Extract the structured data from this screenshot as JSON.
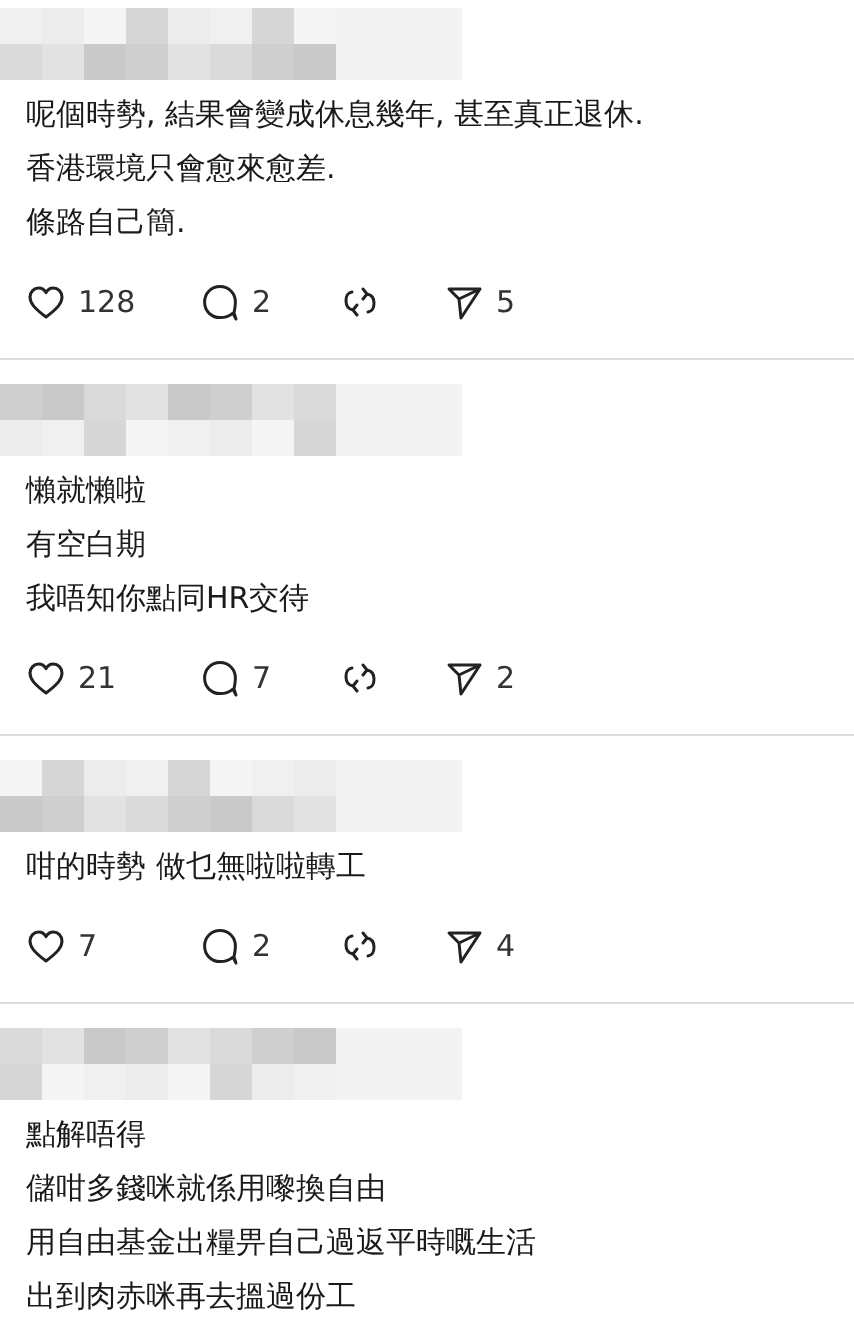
{
  "comments": [
    {
      "lines": [
        "呢個時勢, 結果會變成休息幾年, 甚至真正退休.",
        "香港環境只會愈來愈差.",
        "條路自己簡."
      ],
      "likes": "128",
      "replies": "2",
      "shares": "5"
    },
    {
      "lines": [
        "懶就懶啦",
        "有空白期",
        "我唔知你點同HR交待"
      ],
      "likes": "21",
      "replies": "7",
      "shares": "2"
    },
    {
      "lines": [
        "咁的時勢 做乜無啦啦轉工"
      ],
      "likes": "7",
      "replies": "2",
      "shares": "4"
    },
    {
      "lines": [
        "點解唔得",
        "儲咁多錢咪就係用嚟換自由",
        "用自由基金出糧畀自己過返平時嘅生活",
        "出到肉赤咪再去搵過份工"
      ]
    }
  ]
}
